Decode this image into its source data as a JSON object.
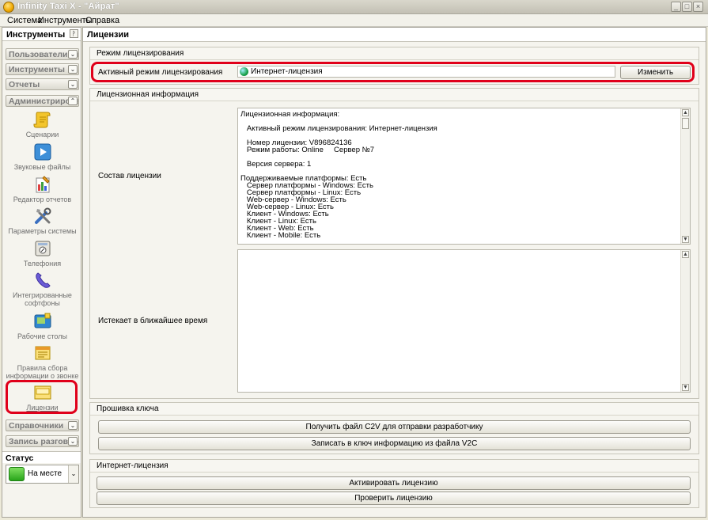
{
  "window": {
    "title": "Infinity Taxi X - \"Айрат\"",
    "min": "_",
    "max": "□",
    "close": "×"
  },
  "menu": [
    "Система",
    "Инструменты",
    "Справка"
  ],
  "left_panel": {
    "title": "Инструменты",
    "pin_glyph": "ᚹ",
    "groups": {
      "users": "Пользователи и пр",
      "tools": "Инструменты",
      "reports": "Отчеты",
      "admin": "Администрирован",
      "refs": "Справочники",
      "recordings": "Запись разговоро"
    },
    "chevron_down": "⌄",
    "chevron_up": "⌃",
    "admin_items": [
      {
        "label": "Сценарии",
        "icon": "scroll-icon"
      },
      {
        "label": "Звуковые файлы",
        "icon": "play-icon"
      },
      {
        "label": "Редактор отчетов",
        "icon": "report-editor-icon"
      },
      {
        "label": "Параметры системы",
        "icon": "tools-icon"
      },
      {
        "label": "Телефония",
        "icon": "telephony-icon"
      },
      {
        "label": "Интегрированные софтфоны",
        "icon": "phone-handset-icon"
      },
      {
        "label": "Рабочие столы",
        "icon": "desktop-icon"
      },
      {
        "label": "Правила сбора информации о звонке",
        "icon": "call-info-icon"
      },
      {
        "label": "Лицензии",
        "icon": "license-icon"
      }
    ],
    "status": {
      "title": "Статус пользователя",
      "value": "На месте",
      "color": "#28a41a"
    }
  },
  "main": {
    "title": "Лицензии",
    "licensing_mode": {
      "title": "Режим лицензирования",
      "row_label": "Активный режим лицензирования",
      "value": "Интернет-лицензия",
      "change_button": "Изменить"
    },
    "license_info": {
      "title": "Лицензионная информация",
      "composition_label": "Состав лицензии",
      "composition_text": "Лицензионная информация:\n\n   Активный режим лицензирования: Интернет-лицензия\n\n   Номер лицензии: V896824136\n   Режим работы: Online     Сервер №7\n\n   Версия сервера: 1\n\nПоддерживаемые платформы: Есть\n   Сервер платформы - Windows: Есть\n   Сервер платформы - Linux: Есть\n   Web-сервер - Windows: Есть\n   Web-сервер - Linux: Есть\n   Клиент - Windows: Есть\n   Клиент - Linux: Есть\n   Клиент - Web: Есть\n   Клиент - Mobile: Есть",
      "expiring_label": "Истекает в ближайшее время",
      "expiring_text": ""
    },
    "key_firmware": {
      "title": "Прошивка ключа",
      "get_c2v_button": "Получить файл C2V для отправки разработчику",
      "write_v2c_button": "Записать в ключ информацию из файла V2C"
    },
    "internet_license": {
      "title": "Интернет-лицензия",
      "activate_button": "Активировать лицензию",
      "check_button": "Проверить лицензию"
    }
  },
  "scroll_up": "▲",
  "scroll_down": "▼",
  "accent": "#e0001a"
}
